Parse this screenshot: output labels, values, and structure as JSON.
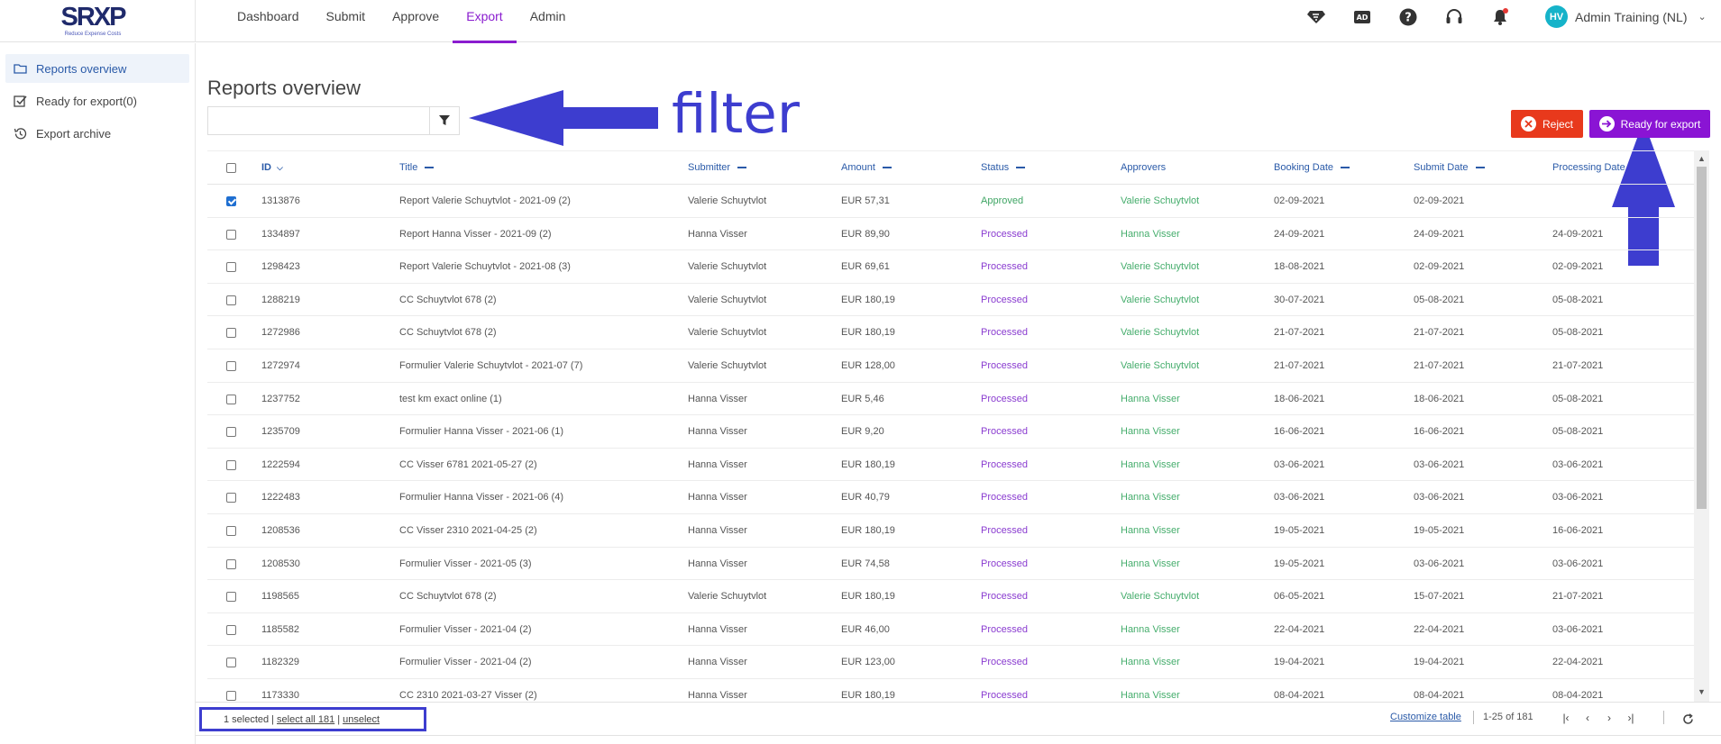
{
  "logo": {
    "text": "SRXP",
    "tagline": "Reduce Expense Costs"
  },
  "nav": [
    {
      "label": "Dashboard"
    },
    {
      "label": "Submit"
    },
    {
      "label": "Approve"
    },
    {
      "label": "Export",
      "active": true
    },
    {
      "label": "Admin"
    }
  ],
  "top_icons": [
    "superman-icon",
    "ad-icon",
    "help-icon",
    "headset-icon",
    "bell-icon"
  ],
  "user": {
    "initials": "HV",
    "name": "Admin Training (NL)"
  },
  "sidebar": [
    {
      "label": "Reports overview",
      "icon": "folder-icon",
      "active": true
    },
    {
      "label": "Ready for export(0)",
      "icon": "checkbox-icon"
    },
    {
      "label": "Export archive",
      "icon": "history-icon"
    }
  ],
  "page_title": "Reports overview",
  "search": {
    "value": "",
    "placeholder": ""
  },
  "annotation": {
    "filter_label": "filter"
  },
  "actions": {
    "reject": "Reject",
    "ready": "Ready for export"
  },
  "colors": {
    "accent": "#8a14d4",
    "reject": "#e8391c",
    "link": "#2a5aa8",
    "approved": "#3fa564",
    "processed": "#8a3cd0",
    "annotation": "#3d3dcf"
  },
  "table": {
    "columns": [
      "ID",
      "Title",
      "Submitter",
      "Amount",
      "Status",
      "Approvers",
      "Booking Date",
      "Submit Date",
      "Processing Date"
    ],
    "rows": [
      {
        "checked": true,
        "id": "1313876",
        "title": "Report Valerie Schuytvlot - 2021-09 (2)",
        "submitter": "Valerie Schuytvlot",
        "amount": "EUR 57,31",
        "status": "Approved",
        "approvers": "Valerie Schuytvlot",
        "booking": "02-09-2021",
        "submit": "02-09-2021",
        "processing": ""
      },
      {
        "checked": false,
        "id": "1334897",
        "title": "Report Hanna Visser - 2021-09 (2)",
        "submitter": "Hanna Visser",
        "amount": "EUR 89,90",
        "status": "Processed",
        "approvers": "Hanna Visser",
        "booking": "24-09-2021",
        "submit": "24-09-2021",
        "processing": "24-09-2021"
      },
      {
        "checked": false,
        "id": "1298423",
        "title": "Report Valerie Schuytvlot - 2021-08 (3)",
        "submitter": "Valerie Schuytvlot",
        "amount": "EUR 69,61",
        "status": "Processed",
        "approvers": "Valerie Schuytvlot",
        "booking": "18-08-2021",
        "submit": "02-09-2021",
        "processing": "02-09-2021"
      },
      {
        "checked": false,
        "id": "1288219",
        "title": "CC Schuytvlot 678 (2)",
        "submitter": "Valerie Schuytvlot",
        "amount": "EUR 180,19",
        "status": "Processed",
        "approvers": "Valerie Schuytvlot",
        "booking": "30-07-2021",
        "submit": "05-08-2021",
        "processing": "05-08-2021"
      },
      {
        "checked": false,
        "id": "1272986",
        "title": "CC Schuytvlot 678 (2)",
        "submitter": "Valerie Schuytvlot",
        "amount": "EUR 180,19",
        "status": "Processed",
        "approvers": "Valerie Schuytvlot",
        "booking": "21-07-2021",
        "submit": "21-07-2021",
        "processing": "05-08-2021"
      },
      {
        "checked": false,
        "id": "1272974",
        "title": "Formulier Valerie Schuytvlot - 2021-07 (7)",
        "submitter": "Valerie Schuytvlot",
        "amount": "EUR 128,00",
        "status": "Processed",
        "approvers": "Valerie Schuytvlot",
        "booking": "21-07-2021",
        "submit": "21-07-2021",
        "processing": "21-07-2021"
      },
      {
        "checked": false,
        "id": "1237752",
        "title": "test km exact online (1)",
        "submitter": "Hanna Visser",
        "amount": "EUR 5,46",
        "status": "Processed",
        "approvers": "Hanna Visser",
        "booking": "18-06-2021",
        "submit": "18-06-2021",
        "processing": "05-08-2021"
      },
      {
        "checked": false,
        "id": "1235709",
        "title": "Formulier Hanna Visser - 2021-06 (1)",
        "submitter": "Hanna Visser",
        "amount": "EUR 9,20",
        "status": "Processed",
        "approvers": "Hanna Visser",
        "booking": "16-06-2021",
        "submit": "16-06-2021",
        "processing": "05-08-2021"
      },
      {
        "checked": false,
        "id": "1222594",
        "title": "CC Visser 6781 2021-05-27 (2)",
        "submitter": "Hanna Visser",
        "amount": "EUR 180,19",
        "status": "Processed",
        "approvers": "Hanna Visser",
        "booking": "03-06-2021",
        "submit": "03-06-2021",
        "processing": "03-06-2021"
      },
      {
        "checked": false,
        "id": "1222483",
        "title": "Formulier Hanna Visser - 2021-06 (4)",
        "submitter": "Hanna Visser",
        "amount": "EUR 40,79",
        "status": "Processed",
        "approvers": "Hanna Visser",
        "booking": "03-06-2021",
        "submit": "03-06-2021",
        "processing": "03-06-2021"
      },
      {
        "checked": false,
        "id": "1208536",
        "title": "CC Visser 2310 2021-04-25 (2)",
        "submitter": "Hanna Visser",
        "amount": "EUR 180,19",
        "status": "Processed",
        "approvers": "Hanna Visser",
        "booking": "19-05-2021",
        "submit": "19-05-2021",
        "processing": "16-06-2021"
      },
      {
        "checked": false,
        "id": "1208530",
        "title": "Formulier Visser - 2021-05 (3)",
        "submitter": "Hanna Visser",
        "amount": "EUR 74,58",
        "status": "Processed",
        "approvers": "Hanna Visser",
        "booking": "19-05-2021",
        "submit": "03-06-2021",
        "processing": "03-06-2021"
      },
      {
        "checked": false,
        "id": "1198565",
        "title": "CC Schuytvlot 678 (2)",
        "submitter": "Valerie Schuytvlot",
        "amount": "EUR 180,19",
        "status": "Processed",
        "approvers": "Valerie Schuytvlot",
        "booking": "06-05-2021",
        "submit": "15-07-2021",
        "processing": "21-07-2021"
      },
      {
        "checked": false,
        "id": "1185582",
        "title": "Formulier Visser - 2021-04 (2)",
        "submitter": "Hanna Visser",
        "amount": "EUR 46,00",
        "status": "Processed",
        "approvers": "Hanna Visser",
        "booking": "22-04-2021",
        "submit": "22-04-2021",
        "processing": "03-06-2021"
      },
      {
        "checked": false,
        "id": "1182329",
        "title": "Formulier Visser - 2021-04 (2)",
        "submitter": "Hanna Visser",
        "amount": "EUR 123,00",
        "status": "Processed",
        "approvers": "Hanna Visser",
        "booking": "19-04-2021",
        "submit": "19-04-2021",
        "processing": "22-04-2021"
      },
      {
        "checked": false,
        "id": "1173330",
        "title": "CC 2310 2021-03-27 Visser (2)",
        "submitter": "Hanna Visser",
        "amount": "EUR 180,19",
        "status": "Processed",
        "approvers": "Hanna Visser",
        "booking": "08-04-2021",
        "submit": "08-04-2021",
        "processing": "08-04-2021"
      }
    ]
  },
  "footer": {
    "selected": "1 selected",
    "select_all": "select all 181",
    "unselect": "unselect",
    "customize": "Customize table",
    "range": "1-25 of 181"
  }
}
